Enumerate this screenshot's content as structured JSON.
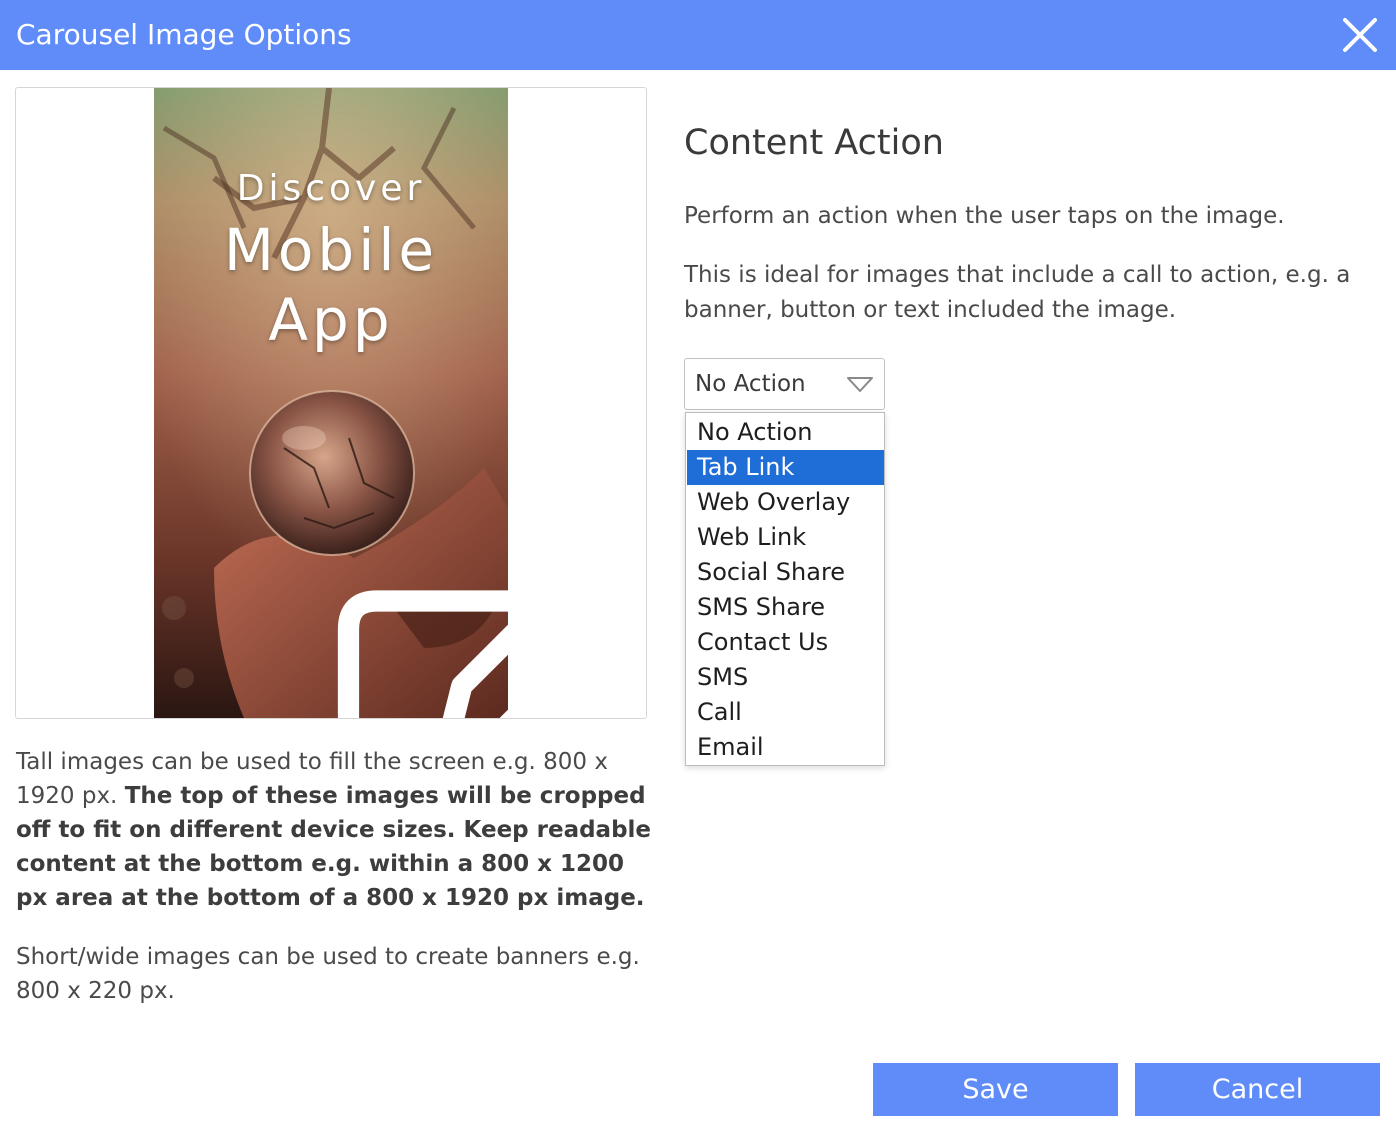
{
  "dialog": {
    "title": "Carousel Image Options",
    "close_icon": "close-icon"
  },
  "preview": {
    "image_text": [
      "Discover",
      "Mobile",
      "App"
    ],
    "edit_icon": "pencil-square-icon"
  },
  "help": {
    "p1_normal": "Tall images can be used to fill the screen e.g. 800 x 1920 px. ",
    "p1_bold": "The top of these images will be cropped off to fit on different device sizes. Keep readable content at the bottom e.g. within a 800 x 1200 px area at the bottom of a 800 x 1920 px image.",
    "p2": "Short/wide images can be used to create banners e.g. 800 x 220 px."
  },
  "content_action": {
    "heading": "Content Action",
    "p1": "Perform an action when the user taps on the image.",
    "p2": "This is ideal for images that include a call to action, e.g. a banner, button or text included the image.",
    "select_value": "No Action",
    "options": [
      "No Action",
      "Tab Link",
      "Web Overlay",
      "Web Link",
      "Social Share",
      "SMS Share",
      "Contact Us",
      "SMS",
      "Call",
      "Email"
    ],
    "highlighted_option": "Tab Link"
  },
  "buttons": {
    "save": "Save",
    "cancel": "Cancel"
  },
  "colors": {
    "accent": "#5f8cf8",
    "option_highlight": "#1f6ed8"
  }
}
